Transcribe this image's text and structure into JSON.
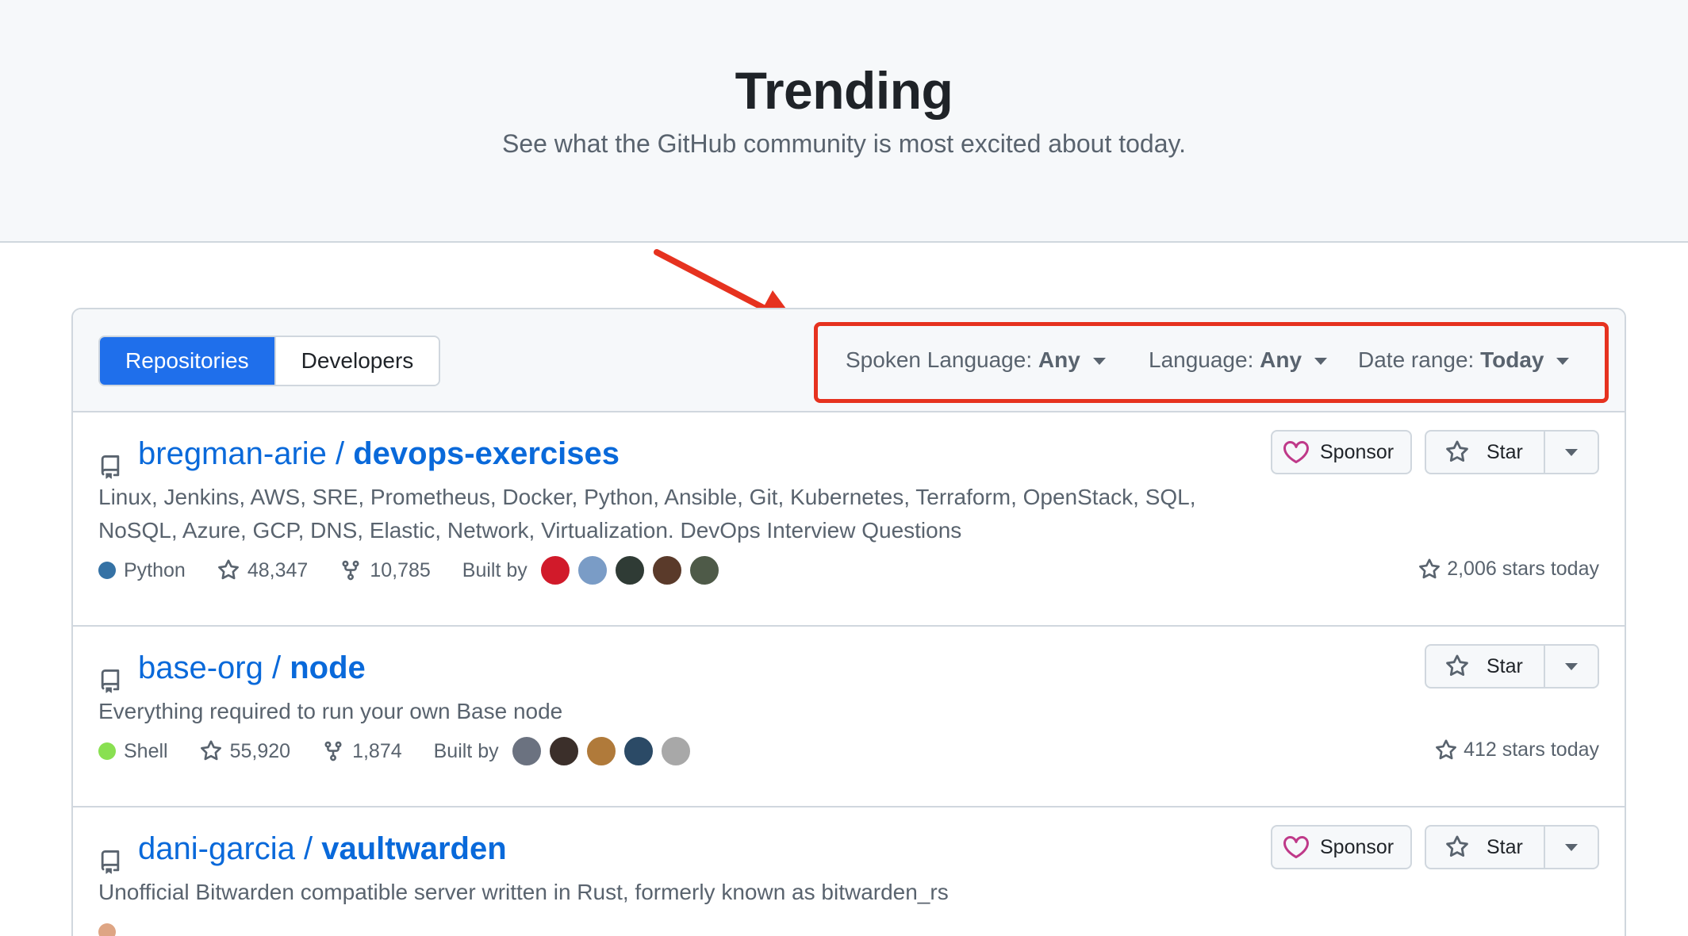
{
  "hero": {
    "title": "Trending",
    "subtitle": "See what the GitHub community is most excited about today."
  },
  "tabs": {
    "repositories": "Repositories",
    "developers": "Developers"
  },
  "filters": {
    "spoken_language_label": "Spoken Language:",
    "spoken_language_value": "Any",
    "language_label": "Language:",
    "language_value": "Any",
    "date_range_label": "Date range:",
    "date_range_value": "Today"
  },
  "repos": [
    {
      "owner": "bregman-arie /",
      "name": "devops-exercises",
      "description": "Linux, Jenkins, AWS, SRE, Prometheus, Docker, Python, Ansible, Git, Kubernetes, Terraform, OpenStack, SQL, NoSQL, Azure, GCP, DNS, Elastic, Network, Virtualization. DevOps Interview Questions",
      "language": "Python",
      "language_color": "#3572A5",
      "stars": "48,347",
      "forks": "10,785",
      "built_by_label": "Built by",
      "stars_today": "2,006 stars today",
      "sponsor_label": "Sponsor",
      "star_label": "Star"
    },
    {
      "owner": "base-org /",
      "name": "node",
      "description": "Everything required to run your own Base node",
      "language": "Shell",
      "language_color": "#89e051",
      "stars": "55,920",
      "forks": "1,874",
      "built_by_label": "Built by",
      "stars_today": "412 stars today",
      "star_label": "Star"
    },
    {
      "owner": "dani-garcia /",
      "name": "vaultwarden",
      "description": "Unofficial Bitwarden compatible server written in Rust, formerly known as bitwarden_rs",
      "language_color": "#dea584",
      "sponsor_label": "Sponsor",
      "star_label": "Star"
    }
  ],
  "colors": {
    "accent": "#1f6feb",
    "link": "#0969da",
    "highlight": "#e6321f",
    "sponsor_heart": "#bf3989"
  }
}
